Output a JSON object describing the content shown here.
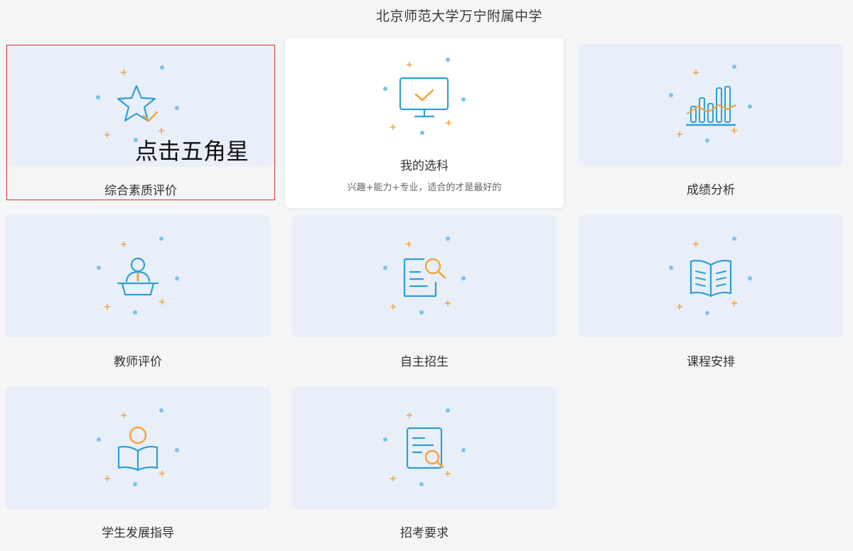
{
  "page": {
    "school_name": "北京师范大学万宁附属中学"
  },
  "cards": [
    {
      "label": "综合素质评价",
      "icon": "star-check-icon",
      "overlay": "点击五角星"
    },
    {
      "label": "我的选科",
      "subtitle": "兴趣+能力+专业，适合的才是最好的",
      "icon": "monitor-check-icon"
    },
    {
      "label": "成绩分析",
      "icon": "bar-chart-icon"
    },
    {
      "label": "教师评价",
      "icon": "teacher-podium-icon"
    },
    {
      "label": "自主招生",
      "icon": "document-search-icon"
    },
    {
      "label": "课程安排",
      "icon": "open-book-icon"
    },
    {
      "label": "学生发展指导",
      "icon": "student-reading-icon"
    },
    {
      "label": "招考要求",
      "icon": "clipboard-search-icon"
    }
  ],
  "colors": {
    "icon_blue": "#2e9fd6",
    "icon_orange": "#f5a43a",
    "dot_blue": "#7cc3e8",
    "tile_bg": "#e8eff8",
    "selected_outline": "#d8302b"
  }
}
